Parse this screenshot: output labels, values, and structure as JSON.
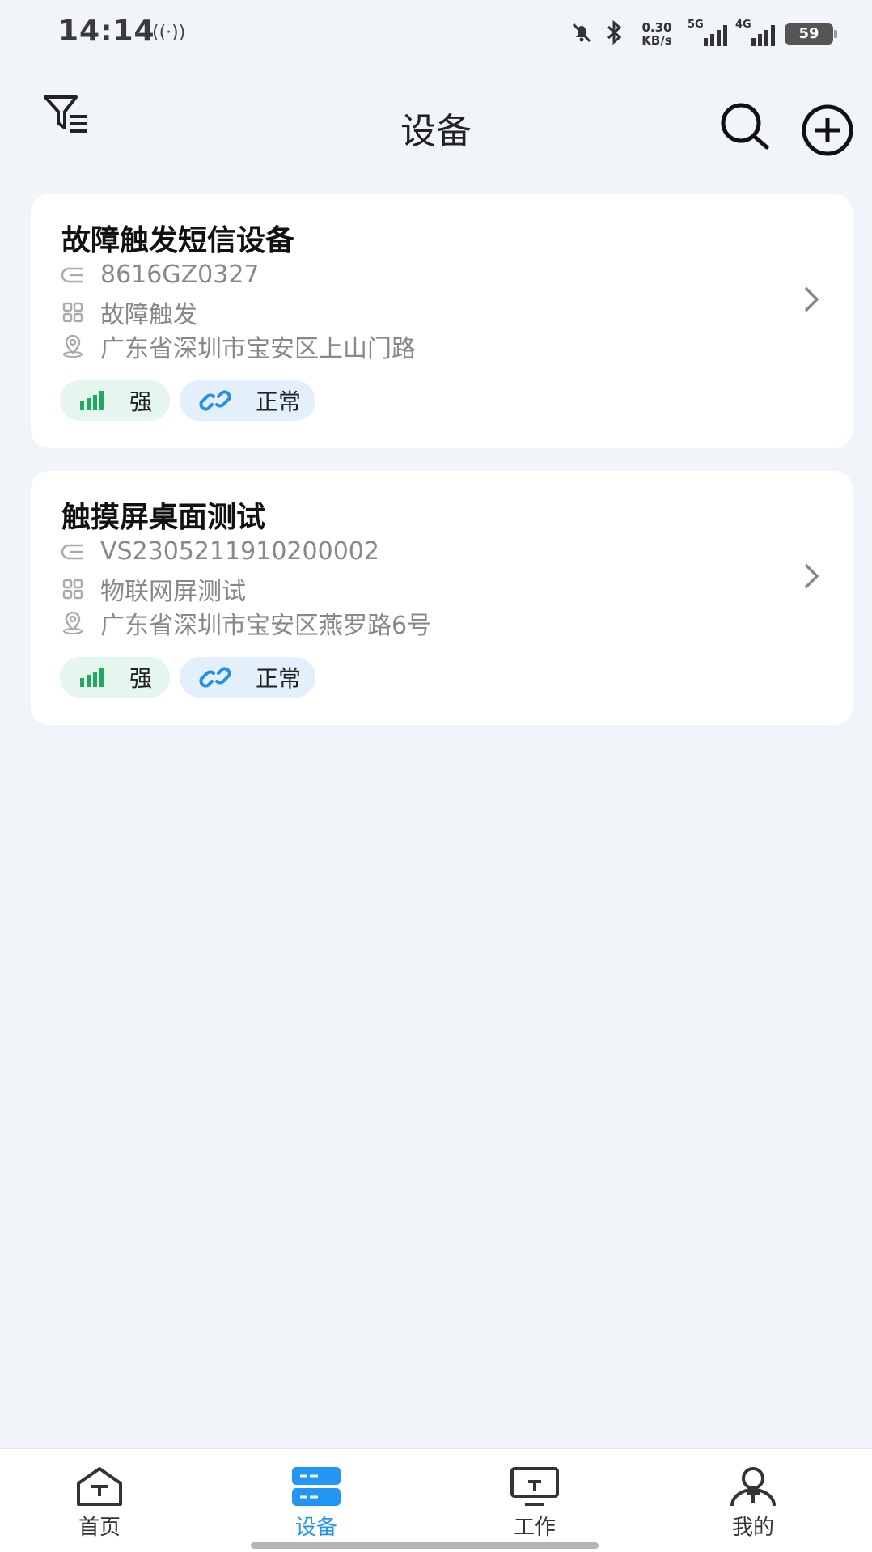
{
  "status_bar": {
    "time": "14:14",
    "hotspot_glyph": "((·))",
    "net_speed_value": "0.30",
    "net_speed_unit": "KB/s",
    "sim1_label": "5G",
    "sim2_label": "4G",
    "battery": "59"
  },
  "header": {
    "title": "设备"
  },
  "devices": [
    {
      "name": "故障触发短信设备",
      "serial": "8616GZ0327",
      "group": "故障触发",
      "address": "广东省深圳市宝安区上山门路",
      "signal_label": "强",
      "status_label": "正常"
    },
    {
      "name": "触摸屏桌面测试",
      "serial": "VS2305211910200002",
      "group": "物联网屏测试",
      "address": "广东省深圳市宝安区燕罗路6号",
      "signal_label": "强",
      "status_label": "正常"
    }
  ],
  "bottom_nav": {
    "items": [
      {
        "label": "首页",
        "icon": "home-icon"
      },
      {
        "label": "设备",
        "icon": "devices-icon"
      },
      {
        "label": "工作",
        "icon": "monitor-icon"
      },
      {
        "label": "我的",
        "icon": "user-icon"
      }
    ],
    "active_index": 1
  },
  "colors": {
    "accent": "#2196f3",
    "signal_green": "#1faa5f",
    "link_blue": "#2a8fe0",
    "background": "#f1f4f9"
  }
}
